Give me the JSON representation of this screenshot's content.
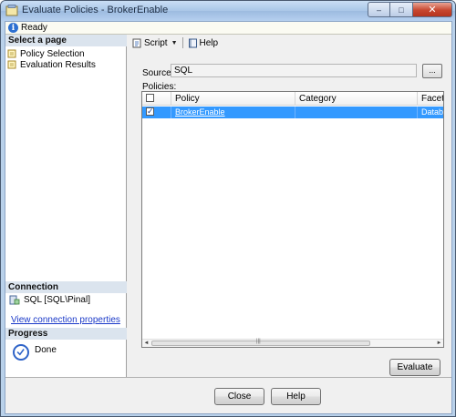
{
  "window": {
    "title": "Evaluate Policies - BrokerEnable",
    "controls": {
      "minimize": "–",
      "maximize": "□",
      "close": "✕"
    }
  },
  "status": {
    "text": "Ready",
    "icon": "info-icon"
  },
  "left_pane": {
    "select_page_header": "Select a page",
    "pages": [
      {
        "label": "Policy Selection",
        "icon": "page-icon",
        "selected": true
      },
      {
        "label": "Evaluation Results",
        "icon": "page-icon",
        "selected": false
      }
    ],
    "connection_header": "Connection",
    "connection_label": "SQL [SQL\\Pinal]",
    "connection_link": "View connection properties",
    "progress_header": "Progress",
    "progress_text": "Done"
  },
  "toolbar": {
    "script_label": "Script",
    "script_dropdown_arrow": "▼",
    "help_label": "Help"
  },
  "form": {
    "source_label": "Source:",
    "source_value": "SQL",
    "browse_label": "...",
    "policies_label": "Policies:"
  },
  "grid": {
    "columns": [
      "",
      "Policy",
      "Category",
      "Facet"
    ],
    "rows": [
      {
        "checked": true,
        "policy": "BrokerEnable",
        "category": "",
        "facet": "Databa"
      }
    ],
    "scroll_left": "◄",
    "scroll_right": "►",
    "scroll_grip": "|||"
  },
  "buttons": {
    "evaluate_label": "Evaluate",
    "close_label": "Close",
    "help_label": "Help"
  },
  "colors": {
    "selection": "#3399ff",
    "link": "#1a39c8",
    "pane_header": "#dbe4ee"
  }
}
